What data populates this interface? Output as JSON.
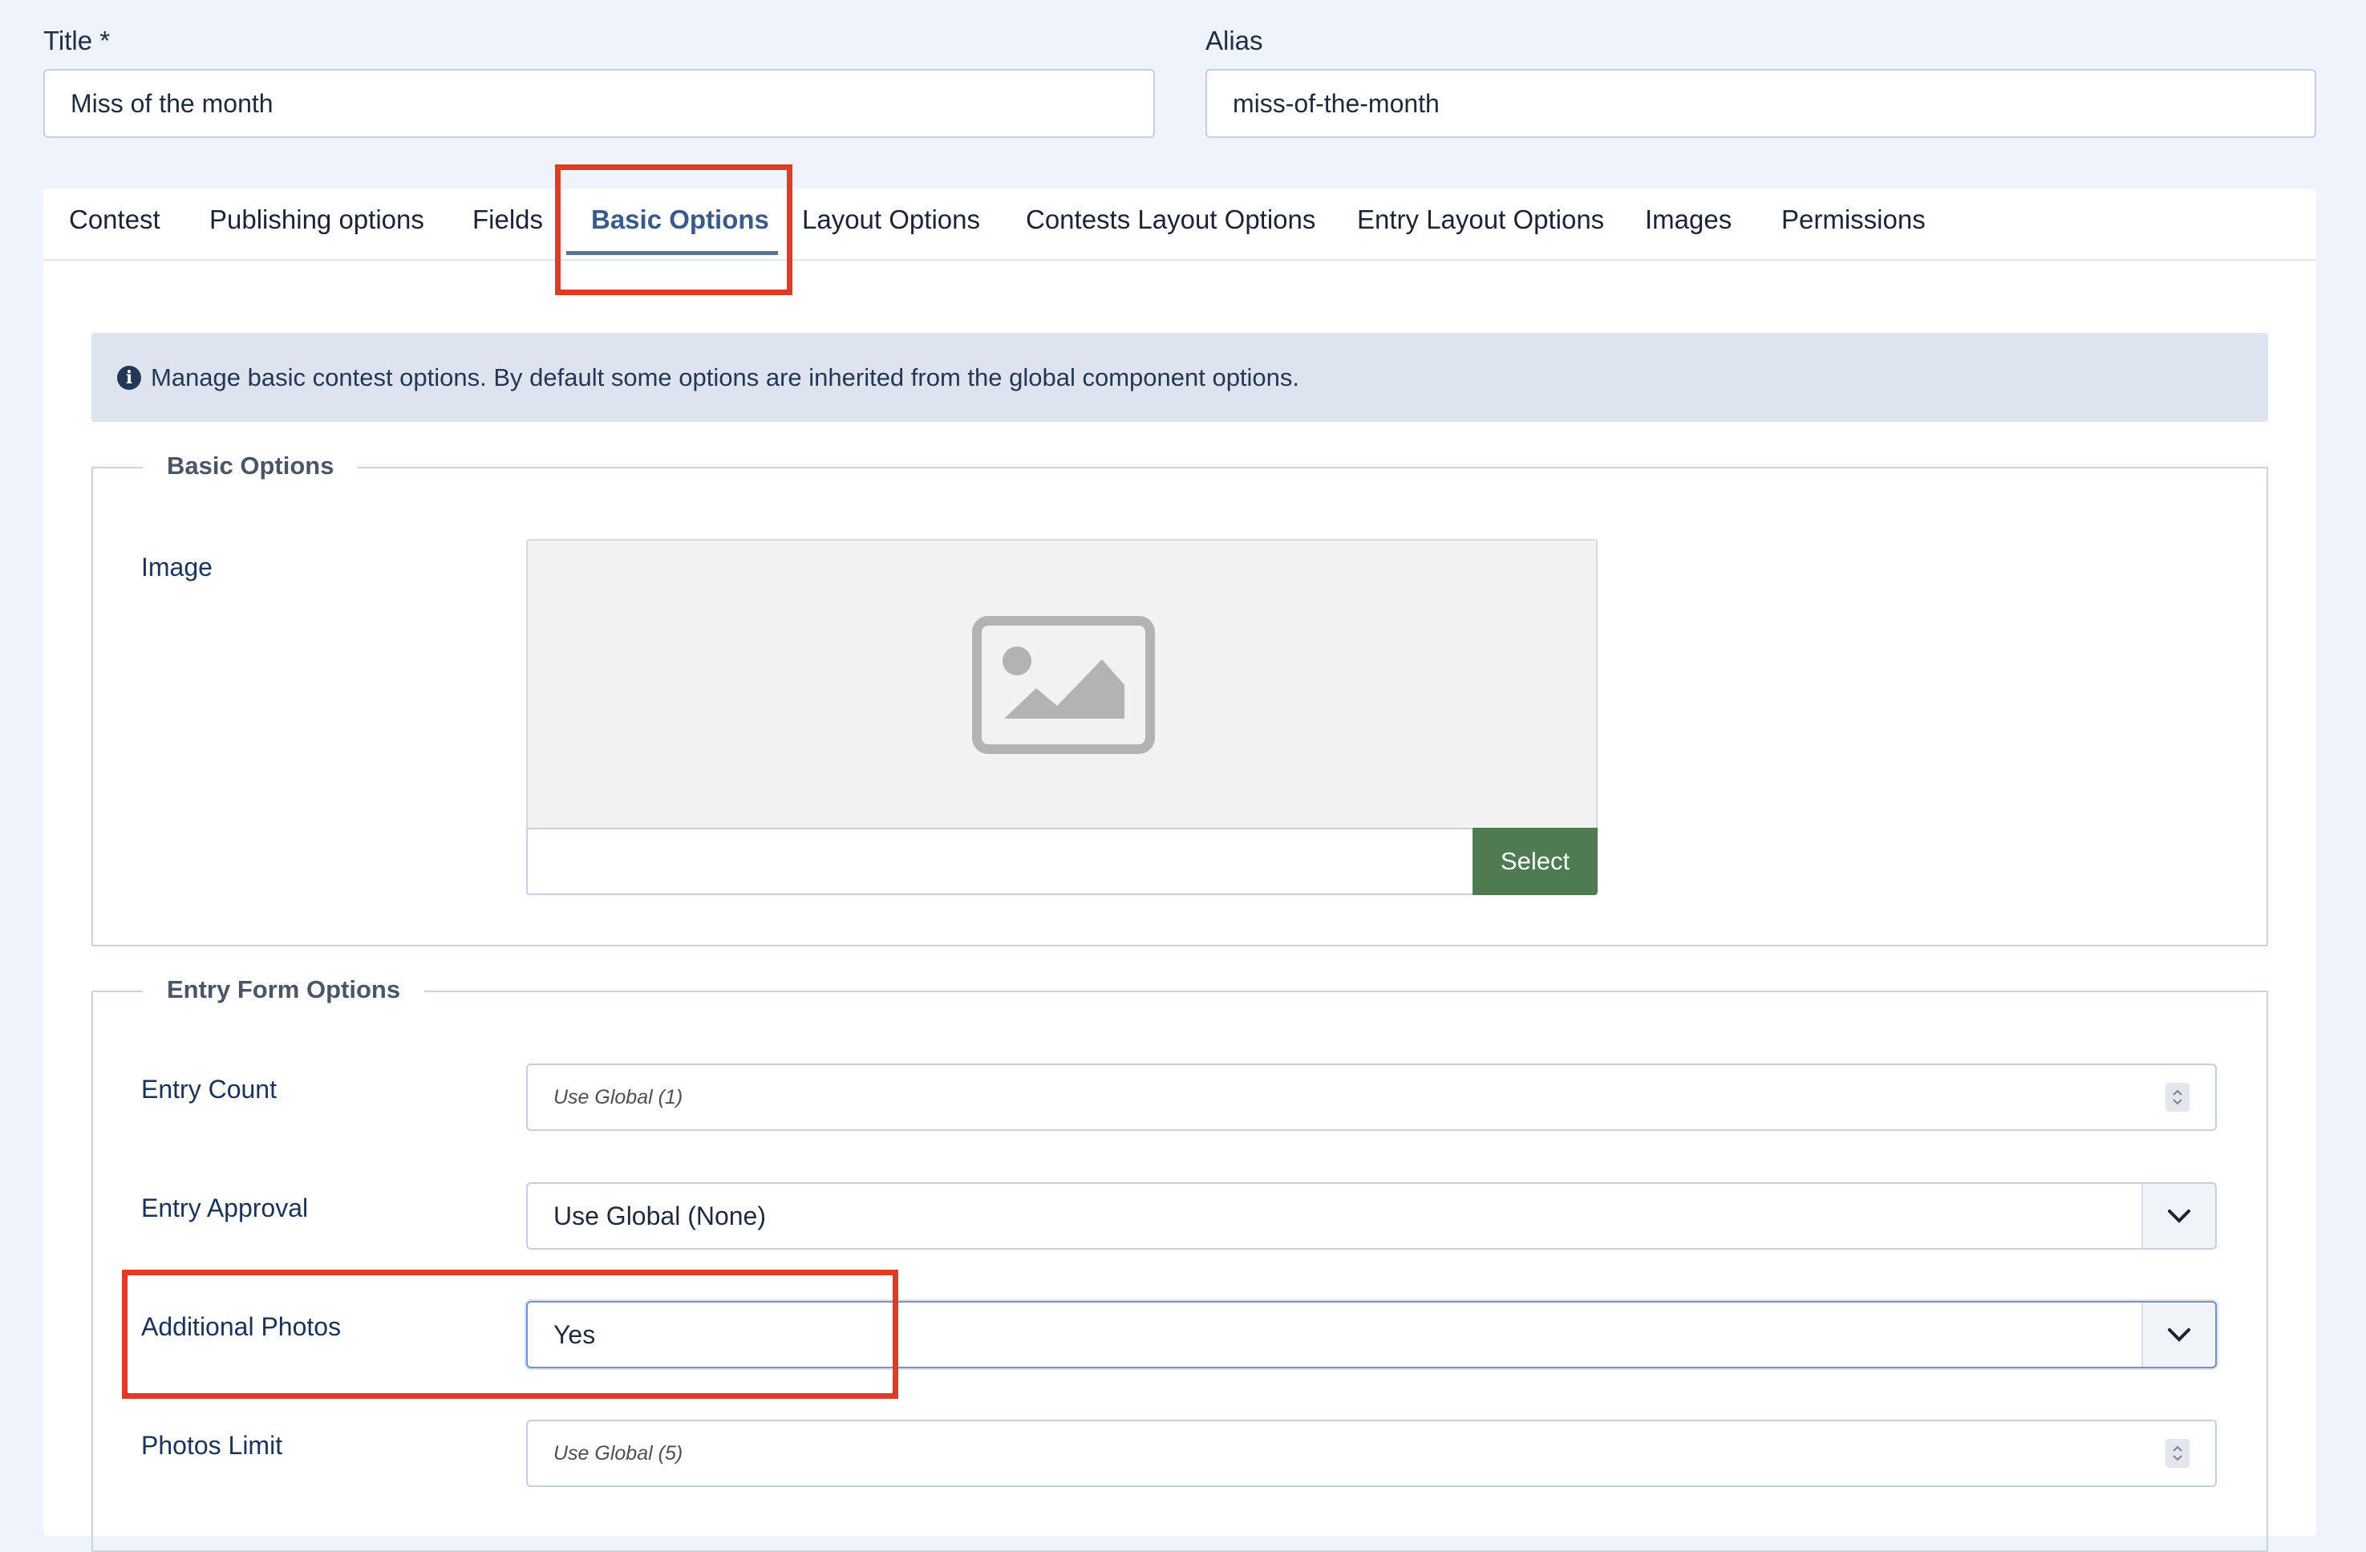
{
  "title_field": {
    "label": "Title *",
    "value": "Miss of the month"
  },
  "alias_field": {
    "label": "Alias",
    "value": "miss-of-the-month"
  },
  "tabs": [
    {
      "label": "Contest"
    },
    {
      "label": "Publishing options"
    },
    {
      "label": "Fields"
    },
    {
      "label": "Basic Options"
    },
    {
      "label": "Layout Options"
    },
    {
      "label": "Contests Layout Options"
    },
    {
      "label": "Entry Layout Options"
    },
    {
      "label": "Images"
    },
    {
      "label": "Permissions"
    }
  ],
  "active_tab": "Basic Options",
  "alert": {
    "icon": "info-circle-icon",
    "text": "Manage basic contest options. By default some options are inherited from the global component options."
  },
  "basic_options": {
    "legend": "Basic Options",
    "image_label": "Image",
    "image_placeholder_icon": "image-placeholder-icon",
    "select_label": "Select"
  },
  "entry_form": {
    "legend": "Entry Form Options",
    "entry_count": {
      "label": "Entry Count",
      "placeholder": "Use Global (1)"
    },
    "entry_approval": {
      "label": "Entry Approval",
      "value": "Use Global (None)"
    },
    "additional_photos": {
      "label": "Additional Photos",
      "value": "Yes"
    },
    "photos_limit": {
      "label": "Photos Limit",
      "placeholder": "Use Global (5)"
    }
  },
  "colors": {
    "highlight": "#e23b25",
    "select_button": "#4e7b52",
    "active_tab": "#3b5a8a"
  }
}
